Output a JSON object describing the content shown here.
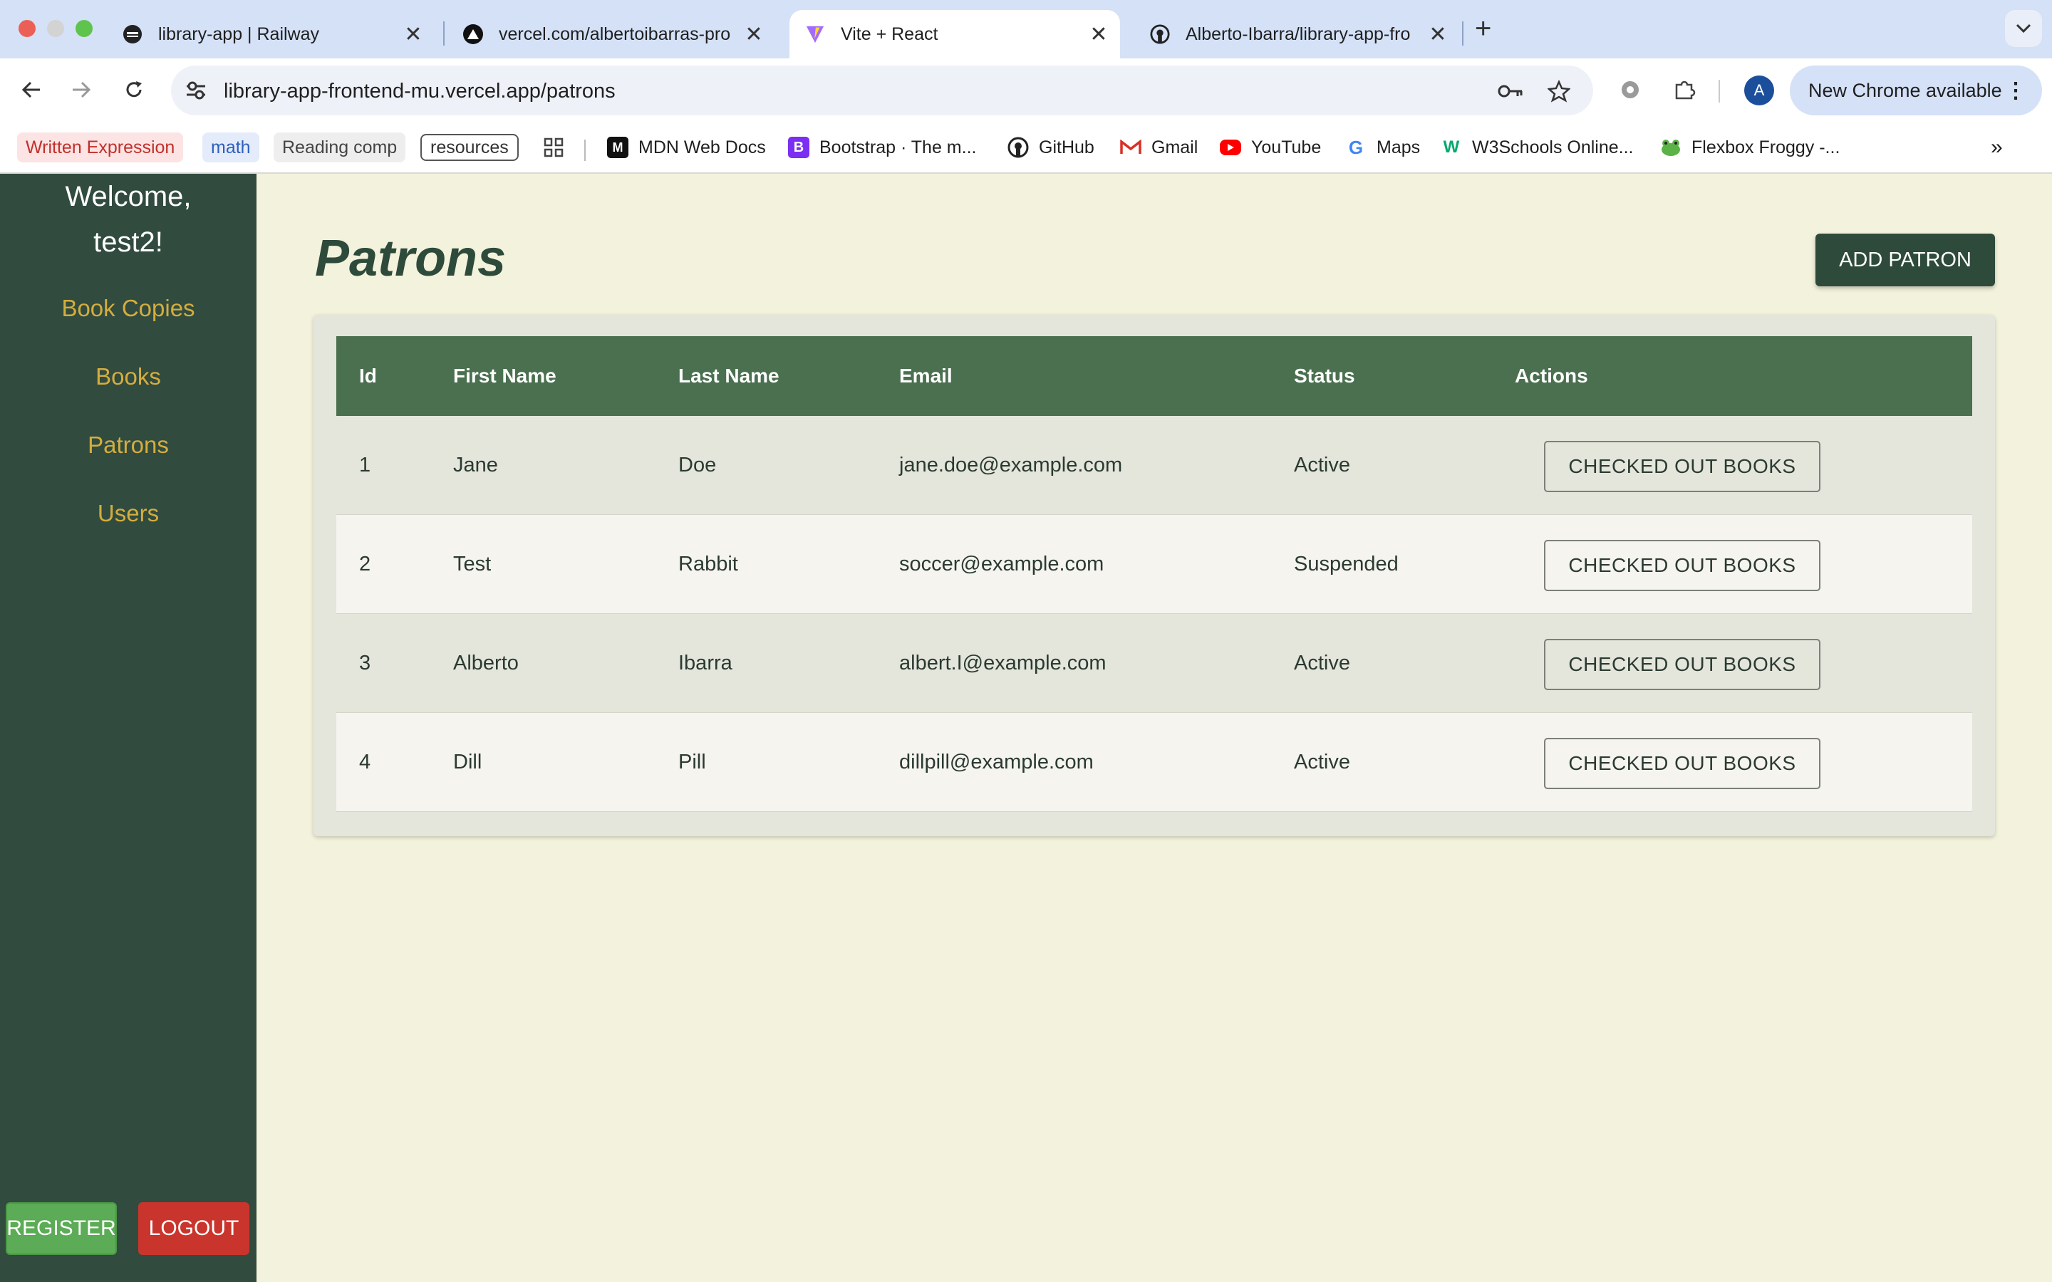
{
  "browser": {
    "tabs": [
      {
        "title": "library-app | Railway",
        "favicon": "railway-icon"
      },
      {
        "title": "vercel.com/albertoibarras-pro",
        "favicon": "vercel-icon"
      },
      {
        "title": "Vite + React",
        "favicon": "vite-icon"
      },
      {
        "title": "Alberto-Ibarra/library-app-fro",
        "favicon": "github-icon"
      }
    ],
    "active_tab": 2,
    "address": {
      "host": "library-app-frontend-mu.vercel.app",
      "path": "/patrons"
    },
    "update_label": "New Chrome available",
    "profile_initial": "A",
    "bookmarks": [
      {
        "label": "Written Expression"
      },
      {
        "label": "math"
      },
      {
        "label": "Reading comp"
      },
      {
        "label": "resources"
      },
      {
        "label": "MDN Web Docs"
      },
      {
        "label": "Bootstrap · The m..."
      },
      {
        "label": "GitHub"
      },
      {
        "label": "Gmail"
      },
      {
        "label": "YouTube"
      },
      {
        "label": "Maps"
      },
      {
        "label": "W3Schools Online..."
      },
      {
        "label": "Flexbox Froggy -..."
      }
    ]
  },
  "sidebar": {
    "welcome_line1": "Welcome,",
    "welcome_line2": "test2!",
    "links": [
      {
        "label": "Book Copies"
      },
      {
        "label": "Books"
      },
      {
        "label": "Patrons"
      },
      {
        "label": "Users"
      }
    ],
    "register_label": "REGISTER",
    "logout_label": "LOGOUT"
  },
  "main": {
    "title": "Patrons",
    "add_label": "ADD PATRON",
    "columns": [
      "Id",
      "First Name",
      "Last Name",
      "Email",
      "Status",
      "Actions"
    ],
    "rows": [
      {
        "id": "1",
        "first": "Jane",
        "last": "Doe",
        "email": "jane.doe@example.com",
        "status": "Active",
        "action": "CHECKED OUT BOOKS"
      },
      {
        "id": "2",
        "first": "Test",
        "last": "Rabbit",
        "email": "soccer@example.com",
        "status": "Suspended",
        "action": "CHECKED OUT BOOKS"
      },
      {
        "id": "3",
        "first": "Alberto",
        "last": "Ibarra",
        "email": "albert.I@example.com",
        "status": "Active",
        "action": "CHECKED OUT BOOKS"
      },
      {
        "id": "4",
        "first": "Dill",
        "last": "Pill",
        "email": "dillpill@example.com",
        "status": "Active",
        "action": "CHECKED OUT BOOKS"
      }
    ]
  },
  "colors": {
    "sidebar_bg": "#314b3e",
    "nav_link": "#d4ad3f",
    "page_bg": "#f3f2dc",
    "table_header": "#4a704f",
    "primary_button": "#2e4a3b",
    "register_button": "#5cab56",
    "logout_button": "#c9352d"
  }
}
